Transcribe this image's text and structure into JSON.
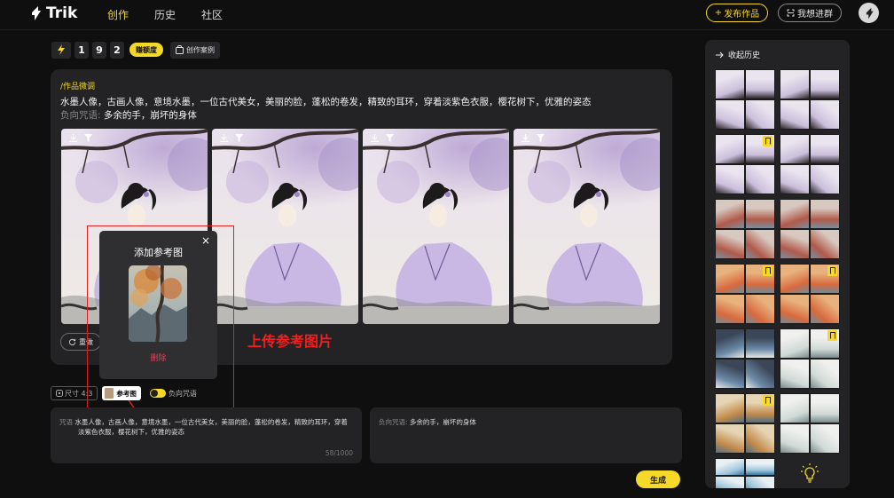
{
  "app": {
    "logo_text": "Trik"
  },
  "nav": {
    "create": "创作",
    "history": "历史",
    "community": "社区"
  },
  "header": {
    "publish_label": "发布作品",
    "publish_plus": "+",
    "join_group_label": "我想进群"
  },
  "credits": {
    "digits": [
      "1",
      "9",
      "2"
    ],
    "earn_label": "赚额度",
    "cases_label": "创作案例"
  },
  "result": {
    "title": "/作品微调",
    "prompt": "水墨人像，古画人像，意境水墨，一位古代美女，美丽的脸，蓬松的卷发，精致的耳环，穿着淡紫色衣服，樱花树下，优雅的姿态",
    "negative_label": "负向咒语:",
    "negative": "多余的手，崩坏的身体",
    "redo_label": "重做",
    "image_count": 4
  },
  "popup": {
    "title": "添加参考图",
    "close": "×",
    "delete_label": "删除"
  },
  "annotation": {
    "text": "上传参考图片"
  },
  "options": {
    "size_label": "尺寸 4:3",
    "ref_label": "参考图",
    "neg_toggle_label": "负向咒语"
  },
  "input_pos": {
    "label": "咒语",
    "text": "水墨人像，古画人像，意境水墨，一位古代美女，美丽的脸，蓬松的卷发，精致的耳环，穿着淡紫色衣服，樱花树下，优雅的姿态",
    "counter": "58/1000"
  },
  "input_neg": {
    "label": "负向咒语:",
    "text": "多余的手，崩坏的身体"
  },
  "generate_label": "生成",
  "history": {
    "title": "收起历史",
    "items": [
      {
        "style": "lilac",
        "bookmarked": false
      },
      {
        "style": "lilac",
        "bookmarked": false
      },
      {
        "style": "lilac",
        "bookmarked": true
      },
      {
        "style": "lilac",
        "bookmarked": false
      },
      {
        "style": "mountain",
        "bookmarked": false
      },
      {
        "style": "mountain",
        "bookmarked": false
      },
      {
        "style": "sunset",
        "bookmarked": true
      },
      {
        "style": "sunset",
        "bookmarked": true
      },
      {
        "style": "night",
        "bookmarked": false
      },
      {
        "style": "mist",
        "bookmarked": true
      },
      {
        "style": "autumn",
        "bookmarked": true
      },
      {
        "style": "mist",
        "bookmarked": false
      },
      {
        "style": "blue",
        "bookmarked": false
      }
    ]
  },
  "colors": {
    "accent": "#f6d829",
    "panel": "#232325",
    "background": "#0f0f10",
    "annotation": "#f02020",
    "delete": "#e0405a"
  }
}
